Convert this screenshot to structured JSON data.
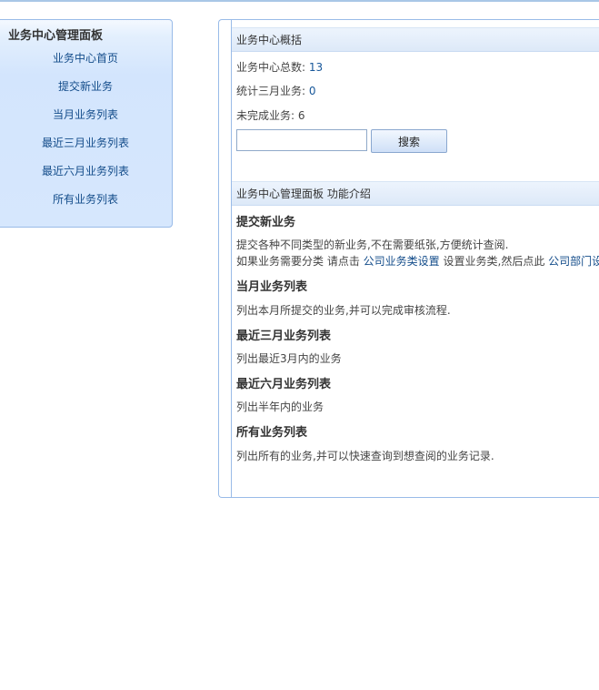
{
  "sidebar": {
    "title": "业务中心管理面板",
    "items": [
      {
        "label": "业务中心首页"
      },
      {
        "label": "提交新业务"
      },
      {
        "label": "当月业务列表"
      },
      {
        "label": "最近三月业务列表"
      },
      {
        "label": "最近六月业务列表"
      },
      {
        "label": "所有业务列表"
      }
    ]
  },
  "overview": {
    "header": "业务中心概括",
    "total_label": "业务中心总数:",
    "total_value": "13",
    "three_month_label": "统计三月业务:",
    "three_month_value": "0",
    "unfinished_label": "未完成业务:",
    "unfinished_value": "6",
    "search_value": "",
    "search_button": "搜索"
  },
  "intro": {
    "header": "业务中心管理面板 功能介绍",
    "sections": [
      {
        "title": "提交新业务",
        "text": "提交各种不同类型的新业务,不在需要纸张,方便统计查阅."
      },
      {
        "title": "当月业务列表",
        "text": "列出本月所提交的业务,并可以完成审核流程."
      },
      {
        "title": "最近三月业务列表",
        "text": "列出最近3月内的业务"
      },
      {
        "title": "最近六月业务列表",
        "text": "列出半年内的业务"
      },
      {
        "title": "所有业务列表",
        "text": "列出所有的业务,并可以快速查询到想查阅的业务记录."
      }
    ],
    "category_prefix": "如果业务需要分类 请点击",
    "category_link": "公司业务类设置",
    "category_middle": "设置业务类,然后点此",
    "dept_link": "公司部门设"
  },
  "colors": {
    "border": "#99bbe8",
    "link": "#134c8a",
    "sidebar_bg": "#d6e7fd"
  }
}
